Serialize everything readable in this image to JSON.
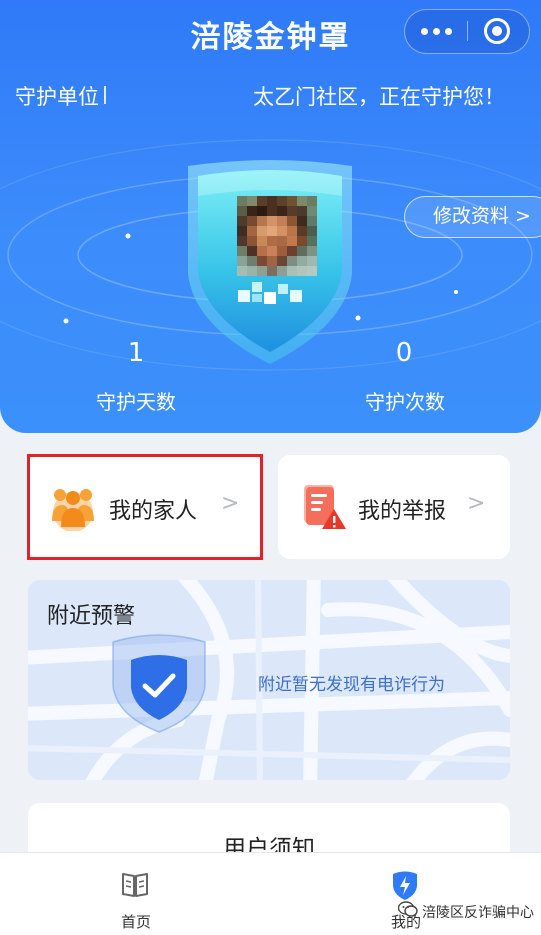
{
  "header": {
    "title": "涪陵金钟罩"
  },
  "guard": {
    "label": "守护单位",
    "text": "太乙门社区，正在守护您！"
  },
  "profile": {
    "edit_label": "修改资料",
    "edit_chevron": ">"
  },
  "stats": [
    {
      "value": "1",
      "label": "守护天数"
    },
    {
      "value": "0",
      "label": "守护次数"
    }
  ],
  "cards": {
    "family": {
      "label": "我的家人",
      "chevron": ">"
    },
    "report": {
      "label": "我的举报",
      "chevron": ">"
    }
  },
  "alert": {
    "title": "附近预警",
    "message": "附近暂无发现有电诈行为"
  },
  "notice": {
    "title": "用户须知"
  },
  "tabs": [
    {
      "label": "首页",
      "icon": "book-icon"
    },
    {
      "label": "我的",
      "icon": "shield-bolt-icon"
    }
  ],
  "watermark": "涪陵区反诈骗中心",
  "colors": {
    "primary": "#2f7af8",
    "highlight_frame": "#e0222a",
    "alert_text": "#3a6fd0"
  }
}
